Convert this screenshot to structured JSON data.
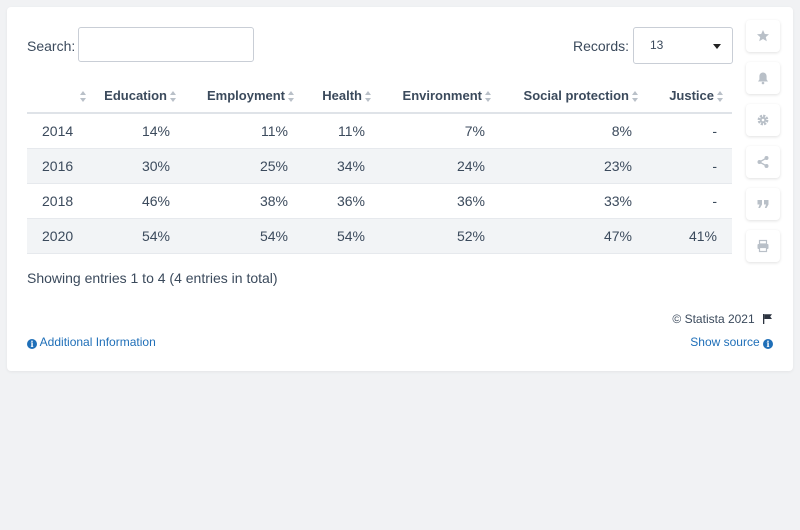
{
  "search": {
    "label": "Search:",
    "value": "",
    "placeholder": ""
  },
  "records": {
    "label": "Records:",
    "selected": "13"
  },
  "table": {
    "columns": [
      "",
      "Education",
      "Employment",
      "Health",
      "Environment",
      "Social protection",
      "Justice"
    ],
    "rows": [
      [
        "2014",
        "14%",
        "11%",
        "11%",
        "7%",
        "8%",
        "-"
      ],
      [
        "2016",
        "30%",
        "25%",
        "34%",
        "24%",
        "23%",
        "-"
      ],
      [
        "2018",
        "46%",
        "38%",
        "36%",
        "36%",
        "33%",
        "-"
      ],
      [
        "2020",
        "54%",
        "54%",
        "54%",
        "52%",
        "47%",
        "41%"
      ]
    ]
  },
  "footer": {
    "entries_info": "Showing entries 1 to 4 (4 entries in total)",
    "copyright": "© Statista 2021",
    "additional_info": "Additional Information",
    "show_source": "Show source"
  },
  "sidebar": {
    "icons": [
      "star-icon",
      "bell-icon",
      "gear-icon",
      "share-icon",
      "quote-icon",
      "print-icon"
    ]
  },
  "colors": {
    "link": "#1f6fb8",
    "icon": "#b9c0c8",
    "row_alt": "#f2f4f6"
  }
}
